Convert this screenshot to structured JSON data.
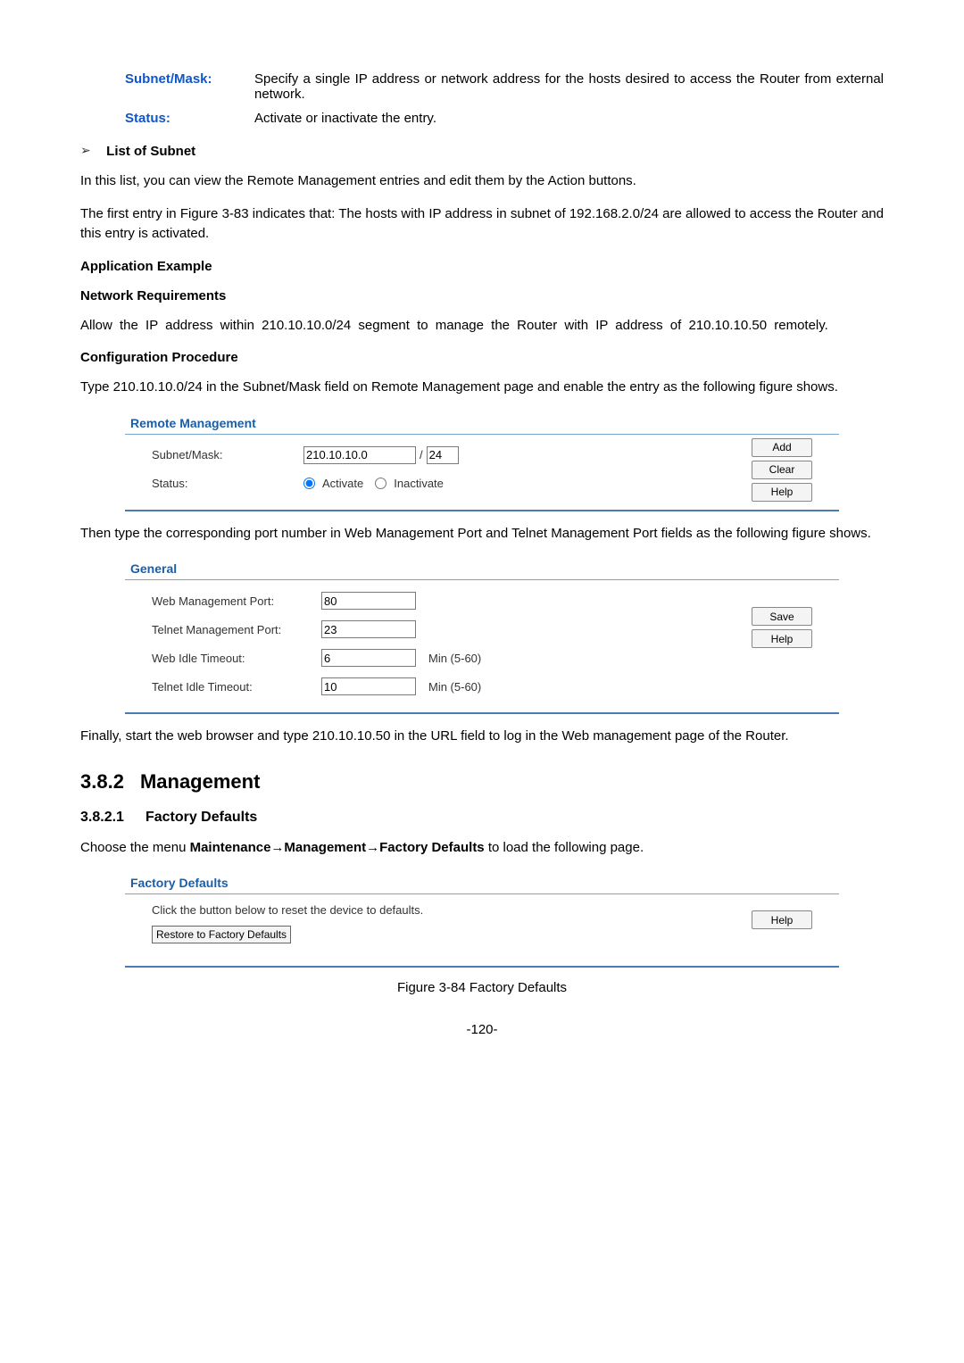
{
  "defs": {
    "subnetMask": {
      "term": "Subnet/Mask:",
      "desc": "Specify a single IP address or network address for the hosts desired to access the Router from external network."
    },
    "status": {
      "term": "Status:",
      "desc": "Activate or inactivate the entry."
    }
  },
  "listOfSubnet": {
    "heading": "List of Subnet",
    "p1": "In this list, you can view the Remote Management entries and edit them by the Action buttons.",
    "p2": "The first entry in Figure 3-83 indicates that: The hosts with IP address in subnet of 192.168.2.0/24 are allowed to access the Router and this entry is activated."
  },
  "appExample": {
    "heading": "Application Example",
    "netReq": {
      "heading": "Network Requirements",
      "p": "Allow the IP address within 210.10.10.0/24 segment to manage the Router with IP address of 210.10.10.50 remotely."
    },
    "configProc": {
      "heading": "Configuration Procedure",
      "p1": "Type 210.10.10.0/24 in the Subnet/Mask field on Remote Management page and enable the entry as the following figure shows."
    }
  },
  "remotePanel": {
    "title": "Remote Management",
    "subnetLabel": "Subnet/Mask:",
    "subnetValue": "210.10.10.0",
    "maskValue": "24",
    "statusLabel": "Status:",
    "activateLabel": "Activate",
    "inactivateLabel": "Inactivate",
    "btnAdd": "Add",
    "btnClear": "Clear",
    "btnHelp": "Help"
  },
  "betweenPanels": {
    "p1": "Then type the corresponding port number in Web Management Port and Telnet Management Port fields as the following figure shows."
  },
  "generalPanel": {
    "title": "General",
    "webPortLabel": "Web Management Port:",
    "webPortValue": "80",
    "telnetPortLabel": "Telnet Management Port:",
    "telnetPortValue": "23",
    "webIdleLabel": "Web Idle Timeout:",
    "webIdleValue": "6",
    "telnetIdleLabel": "Telnet Idle Timeout:",
    "telnetIdleValue": "10",
    "minHint": "Min (5-60)",
    "btnSave": "Save",
    "btnHelp": "Help"
  },
  "afterGeneral": {
    "p1": "Finally, start the web browser and type 210.10.10.50 in the URL field to log in the Web management page of the Router."
  },
  "sec382": {
    "num": "3.8.2",
    "title": "Management"
  },
  "sec3821": {
    "num": "3.8.2.1",
    "title": "Factory Defaults",
    "p_pre": "Choose the menu ",
    "p_bold": "Maintenance→Management→Factory Defaults",
    "p_post": " to load the following page."
  },
  "factoryPanel": {
    "title": "Factory Defaults",
    "text": "Click the button below to reset the device to defaults.",
    "btnRestore": "Restore to Factory Defaults",
    "btnHelp": "Help"
  },
  "figCaption": "Figure 3-84 Factory Defaults",
  "pageNumber": "-120-"
}
